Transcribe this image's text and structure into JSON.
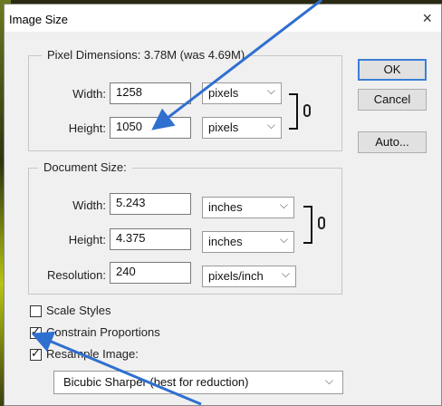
{
  "dialog": {
    "title": "Image Size",
    "close_glyph": "×"
  },
  "pixel_dimensions": {
    "legend": "Pixel Dimensions:  3.78M (was 4.69M)",
    "width_label": "Width:",
    "width_value": "1258",
    "width_unit": "pixels",
    "height_label": "Height:",
    "height_value": "1050",
    "height_unit": "pixels"
  },
  "document_size": {
    "legend": "Document Size:",
    "width_label": "Width:",
    "width_value": "5.243",
    "width_unit": "inches",
    "height_label": "Height:",
    "height_value": "4.375",
    "height_unit": "inches",
    "resolution_label": "Resolution:",
    "resolution_value": "240",
    "resolution_unit": "pixels/inch"
  },
  "buttons": {
    "ok": "OK",
    "cancel": "Cancel",
    "auto": "Auto..."
  },
  "options": {
    "scale_styles": {
      "label": "Scale Styles",
      "checked": false
    },
    "constrain_proportions": {
      "label": "Constrain Proportions",
      "checked": true
    },
    "resample_image": {
      "label": "Resample Image:",
      "checked": true
    },
    "resample_method": "Bicubic Sharper (best for reduction)"
  },
  "glyphs": {
    "chevron": "⌵",
    "tick": "✓"
  },
  "colors": {
    "annotation_arrow": "#2f6fd0"
  }
}
